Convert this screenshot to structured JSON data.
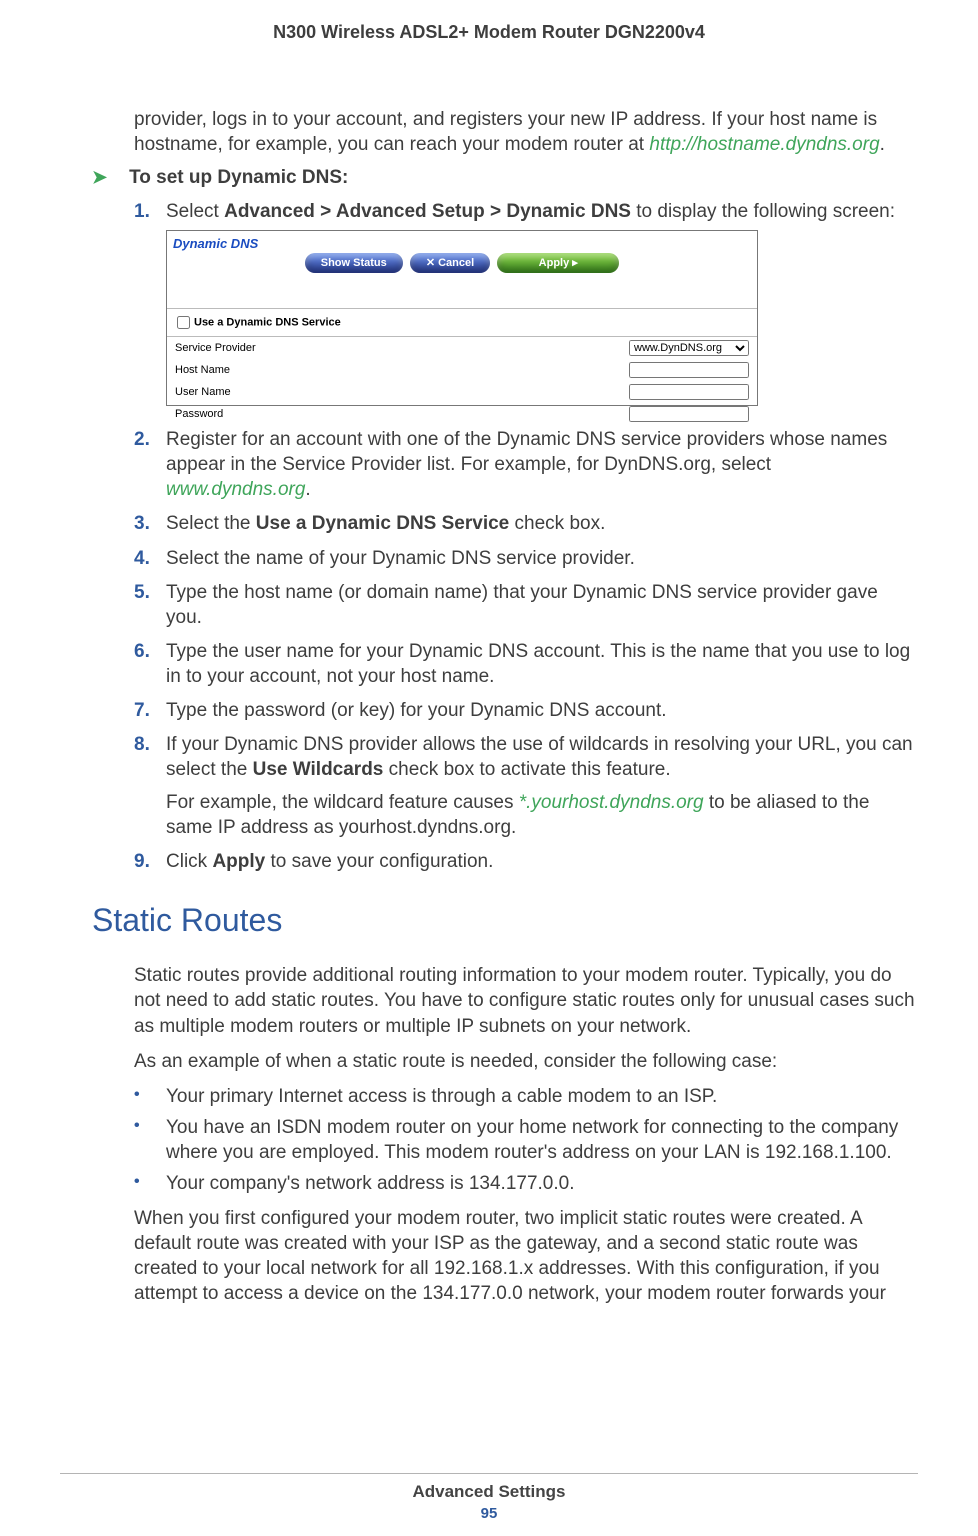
{
  "header": {
    "running_title": "N300 Wireless ADSL2+ Modem Router DGN2200v4"
  },
  "intro": {
    "text_a": "provider, logs in to your account, and registers your new IP address. If your host name is hostname, for example, you can reach your modem router at ",
    "link": "http://hostname.dyndns.org",
    "text_b": "."
  },
  "procedure": {
    "arrow": "➤",
    "heading": "To set up Dynamic DNS:",
    "steps": {
      "s1": {
        "num": "1.",
        "pre": "Select ",
        "bold": "Advanced > Advanced Setup > Dynamic DNS",
        "post": " to display the following screen:"
      },
      "s2": {
        "num": "2.",
        "pre": "Register for an account with one of the Dynamic DNS service providers whose names appear in the Service Provider list. For example, for DynDNS.org, select ",
        "link": "www.dyndns.org",
        "post": "."
      },
      "s3": {
        "num": "3.",
        "pre": "Select the ",
        "bold": "Use a Dynamic DNS Service",
        "post": " check box."
      },
      "s4": {
        "num": "4.",
        "text": "Select the name of your Dynamic DNS service provider."
      },
      "s5": {
        "num": "5.",
        "text": "Type the host name (or domain name) that your Dynamic DNS service provider gave you."
      },
      "s6": {
        "num": "6.",
        "text": "Type the user name for your Dynamic DNS account. This is the name that you use to log in to your account, not your host name."
      },
      "s7": {
        "num": "7.",
        "text": "Type the password (or key) for your Dynamic DNS account."
      },
      "s8": {
        "num": "8.",
        "pre": "If your Dynamic DNS provider allows the use of wildcards in resolving your URL, you can select the ",
        "bold": "Use Wildcards",
        "post": " check box to activate this feature.",
        "sub_pre": "For example, the wildcard feature causes ",
        "sub_link": "*.yourhost.dyndns.org",
        "sub_post": " to be aliased to the same IP address as yourhost.dyndns.org."
      },
      "s9": {
        "num": "9.",
        "pre": "Click ",
        "bold": "Apply",
        "post": " to save your configuration."
      }
    }
  },
  "shot": {
    "title": "Dynamic DNS",
    "btn_status": "Show Status",
    "btn_cancel": "✕    Cancel",
    "btn_apply": "Apply    ▸",
    "checkbox": "Use a Dynamic DNS Service",
    "rows": {
      "provider_lbl": "Service Provider",
      "provider_val": "www.DynDNS.org",
      "host_lbl": "Host Name",
      "user_lbl": "User Name",
      "pass_lbl": "Password"
    }
  },
  "section": {
    "heading": "Static Routes",
    "p1": "Static routes provide additional routing information to your modem router. Typically, you do not need to add static routes. You have to configure static routes only for unusual cases such as multiple modem routers or multiple IP subnets on your network.",
    "p2": "As an example of when a static route is needed, consider the following case:",
    "bullets": {
      "b1": "Your primary Internet access is through a cable modem to an ISP.",
      "b2": "You have an ISDN modem router on your home network for connecting to the company where you are employed. This modem router's address on your LAN is 192.168.1.100.",
      "b3": "Your company's network address is 134.177.0.0."
    },
    "p3": "When you first configured your modem router, two implicit static routes were created. A default route was created with your ISP as the gateway, and a second static route was created to your local network for all 192.168.1.x addresses. With this configuration, if you attempt to access a device on the 134.177.0.0 network, your modem router forwards your"
  },
  "footer": {
    "section": "Advanced Settings",
    "page": "95",
    "bullet_glyph": "•"
  }
}
